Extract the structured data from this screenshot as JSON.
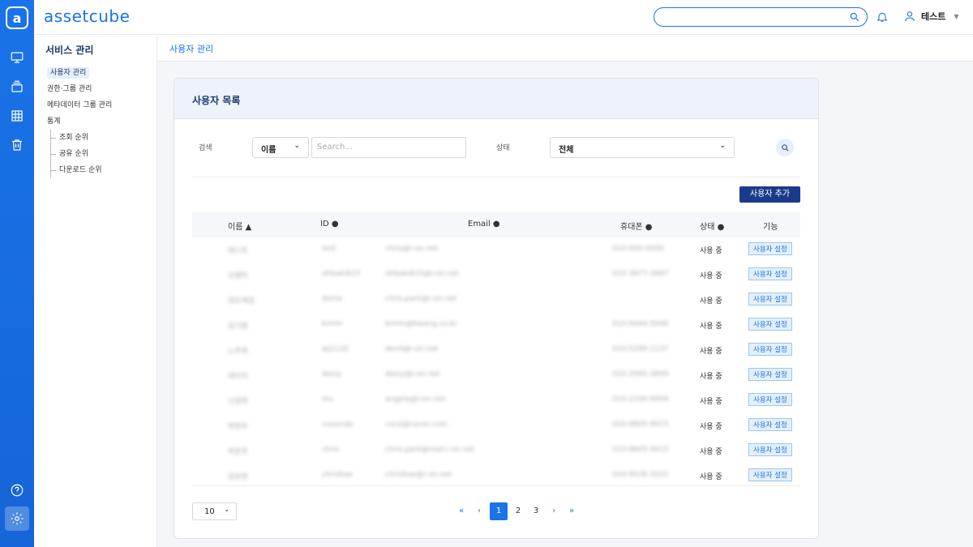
{
  "brand": "assetcube",
  "rail_icons": [
    "monitor-icon",
    "stack-icon",
    "grid-icon",
    "trash-icon",
    "help-icon",
    "settings-icon"
  ],
  "header": {
    "search_placeholder": "",
    "user_name": "테스트"
  },
  "sidebar": {
    "title": "서비스 관리",
    "items": [
      "사용자 관리",
      "권한·그룹 관리",
      "메타데이터 그룹 관리",
      "통계"
    ],
    "sub_items": [
      "조회 순위",
      "공유 순위",
      "다운로드 순위"
    ]
  },
  "breadcrumb": "사용자 관리",
  "card": {
    "title": "사용자 목록",
    "search_label": "검색",
    "search_field": "이름",
    "search_placeholder": "Search...",
    "status_label": "상태",
    "status_value": "전체",
    "add_button": "사용자 추가"
  },
  "table": {
    "columns": [
      "이름 ▲",
      "ID ●",
      "Email ●",
      "휴대폰 ●",
      "상태 ●",
      "기능"
    ],
    "rows": [
      {
        "name": "테스트",
        "id": "test",
        "email": "chris@i-on.net",
        "phone": "010-000-0000",
        "status": "사용 중",
        "action": "사용자 설정"
      },
      {
        "name": "오병탁",
        "id": "ohbaki815",
        "email": "ohbaki815@i-on.net",
        "phone": "010-3877-3687",
        "status": "사용 중",
        "action": "사용자 설정"
      },
      {
        "name": "데모계정",
        "id": "demo",
        "email": "chris.park@i-on.net",
        "phone": "",
        "status": "사용 중",
        "action": "사용자 설정"
      },
      {
        "name": "김기범",
        "id": "kimm",
        "email": "kimm@kwang.co.kr",
        "phone": "010-9444-5046",
        "status": "사용 중",
        "action": "사용자 설정"
      },
      {
        "name": "노주희",
        "id": "wj1120",
        "email": "devil@i-on.net",
        "phone": "010-5299-1137",
        "status": "사용 중",
        "action": "사용자 설정"
      },
      {
        "name": "테이지",
        "id": "daisy",
        "email": "daisy@i-on.net",
        "phone": "010-2065-3849",
        "status": "사용 중",
        "action": "사용자 설정"
      },
      {
        "name": "신영희",
        "id": "ms",
        "email": "angela@i-on.net",
        "phone": "010-2100-9004",
        "status": "사용 중",
        "action": "사용자 설정"
      },
      {
        "name": "박현주",
        "id": "coeanda",
        "email": "coco@naver.com",
        "phone": "010-8805-9415",
        "status": "사용 중",
        "action": "사용자 설정"
      },
      {
        "name": "박준우",
        "id": "chris",
        "email": "chris.park@mail.i-on.net",
        "phone": "010-8605-9415",
        "status": "사용 중",
        "action": "사용자 설정"
      },
      {
        "name": "김보현",
        "id": "chrisbae",
        "email": "chrisbae@i-on.net",
        "phone": "010-9536-3225",
        "status": "사용 중",
        "action": "사용자 설정"
      }
    ]
  },
  "pagination": {
    "page_size": "10",
    "first": "«",
    "prev": "‹",
    "next": "›",
    "last": "»",
    "pages": [
      "1",
      "2",
      "3"
    ],
    "current": "1"
  },
  "colors": {
    "accent": "#1a73e8",
    "navy": "#1a3a8b",
    "tag_bg": "#e3f0fc"
  }
}
